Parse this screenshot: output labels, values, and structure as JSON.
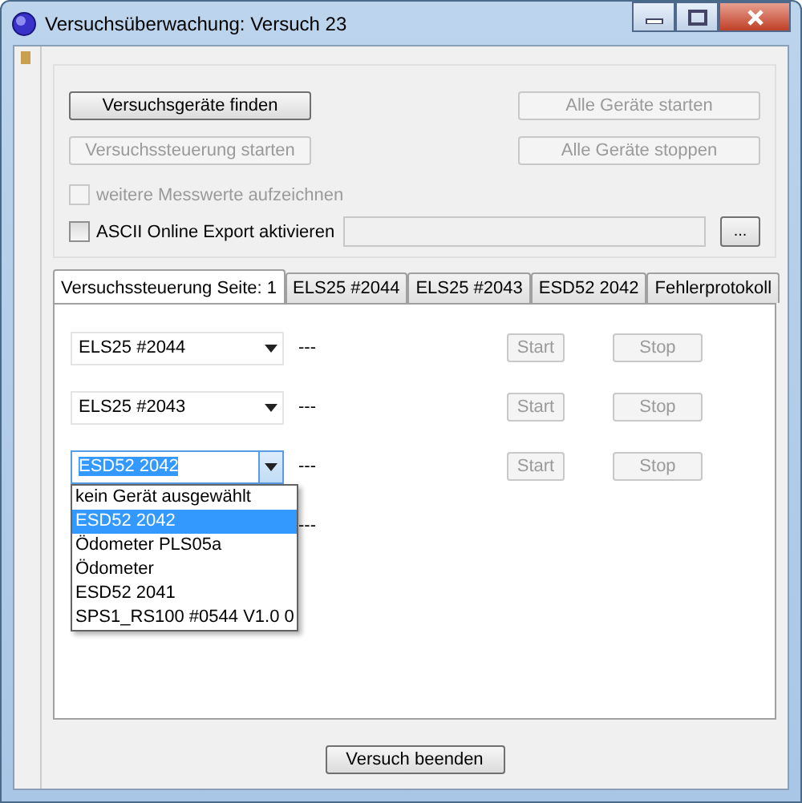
{
  "window": {
    "title": "Versuchsüberwachung: Versuch 23"
  },
  "controls": {
    "buttons": [
      {
        "label": "Versuchsgeräte finden",
        "disabled": false
      },
      {
        "label": "Alle Geräte starten",
        "disabled": true
      },
      {
        "label": "Versuchssteuerung starten",
        "disabled": true
      },
      {
        "label": "Alle Geräte stoppen",
        "disabled": true
      }
    ],
    "checkboxes": [
      {
        "label": "weitere Messwerte aufzeichnen",
        "checked": false,
        "disabled": true
      },
      {
        "label": "ASCII Online Export aktivieren",
        "checked": false,
        "disabled": false
      }
    ],
    "browse_button": {
      "label": "...",
      "disabled": false
    }
  },
  "tabs": [
    {
      "label": "Versuchssteuerung Seite: 1",
      "selected": true
    },
    {
      "label": "ELS25 #2044",
      "selected": false
    },
    {
      "label": "ELS25 #2043",
      "selected": false
    },
    {
      "label": "ESD52 2042",
      "selected": false
    },
    {
      "label": "Fehlerprotokoll",
      "selected": false
    }
  ],
  "device_rows": [
    {
      "device": "ELS25 #2044",
      "open": false,
      "status": "---",
      "start": {
        "label": "Start",
        "disabled": true
      },
      "stop": {
        "label": "Stop",
        "disabled": true
      }
    },
    {
      "device": "ELS25 #2043",
      "open": false,
      "status": "---",
      "start": {
        "label": "Start",
        "disabled": true
      },
      "stop": {
        "label": "Stop",
        "disabled": true
      }
    },
    {
      "device": "ESD52 2042",
      "open": true,
      "status": "---",
      "start": {
        "label": "Start",
        "disabled": true
      },
      "stop": {
        "label": "Stop",
        "disabled": true
      }
    },
    {
      "status": "---"
    }
  ],
  "dropdown": {
    "items": [
      {
        "label": "kein Gerät ausgewählt",
        "selected": false
      },
      {
        "label": "ESD52 2042",
        "selected": true
      },
      {
        "label": "Ödometer PLS05a",
        "selected": false
      },
      {
        "label": "Ödometer",
        "selected": false
      },
      {
        "label": "ESD52 2041",
        "selected": false
      },
      {
        "label": "SPS1_RS100 #0544 V1.0 0",
        "selected": false
      }
    ]
  },
  "footer": {
    "button": {
      "label": "Versuch beenden",
      "disabled": false
    }
  }
}
